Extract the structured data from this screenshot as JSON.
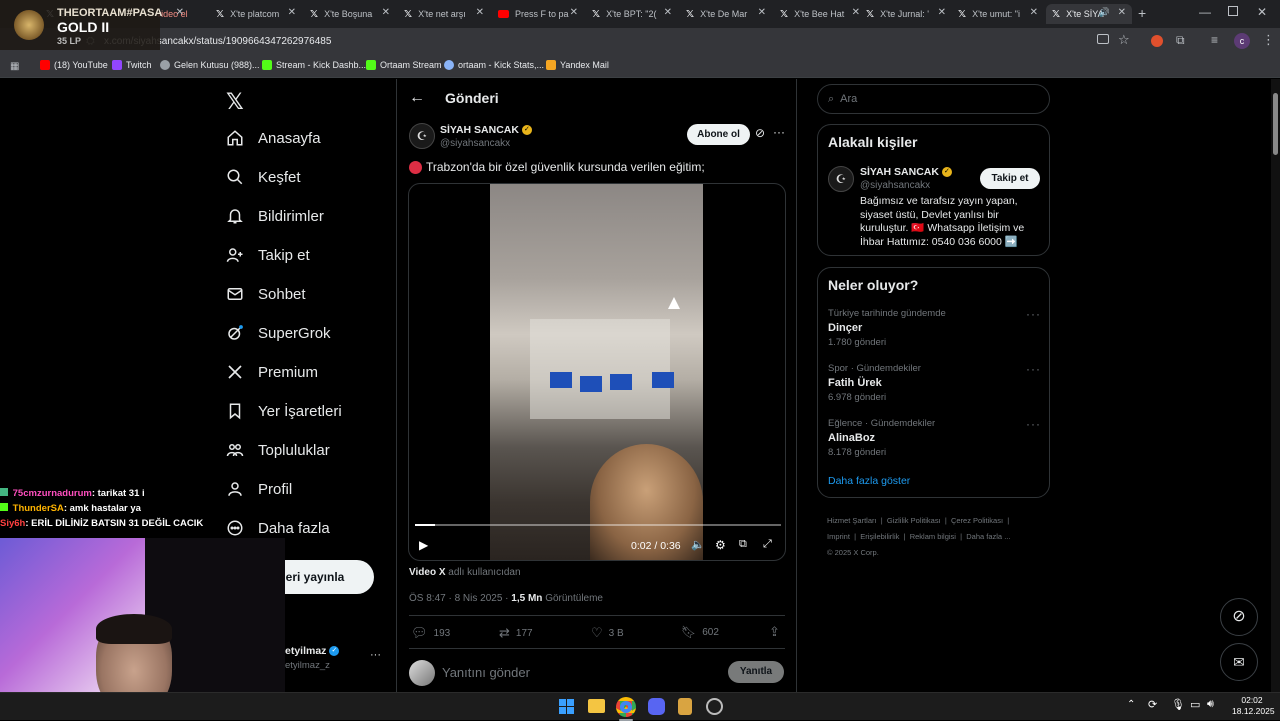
{
  "browser": {
    "tabs": [
      {
        "label": "St",
        "active": false
      },
      {
        "label": "X'te platcom",
        "active": false
      },
      {
        "label": "X'te Boşuna",
        "active": false
      },
      {
        "label": "X'te net arşı",
        "active": false
      },
      {
        "label": "Press F to pa",
        "active": false
      },
      {
        "label": "X'te BPT: \"2(",
        "active": false
      },
      {
        "label": "X'te De Mar",
        "active": false
      },
      {
        "label": "X'te Bee Hat",
        "active": false
      },
      {
        "label": "X'te Jurnal: '",
        "active": false
      },
      {
        "label": "X'te umut: \"i",
        "active": false
      },
      {
        "label": "X'te SİYA",
        "active": true
      }
    ],
    "url": "x.com/siyahsancakx/status/1909664347262976485",
    "bookmarks": [
      "(18) YouTube",
      "Twitch",
      "Gelen Kutusu (988)...",
      "Stream - Kick Dashb...",
      "Ortaam Stream",
      "ortaam - Kick Stats,...",
      "Yandex Mail"
    ]
  },
  "stream_overlay": {
    "name": "THEORTAAM#PASA",
    "rank": "GOLD II",
    "lp": "35 LP",
    "tab_fragment": "video el"
  },
  "sidebar": {
    "items": [
      {
        "label": "Anasayfa",
        "icon": "home-icon"
      },
      {
        "label": "Keşfet",
        "icon": "search-icon"
      },
      {
        "label": "Bildirimler",
        "icon": "bell-icon"
      },
      {
        "label": "Takip et",
        "icon": "follow-icon"
      },
      {
        "label": "Sohbet",
        "icon": "mail-icon"
      },
      {
        "label": "SuperGrok",
        "icon": "grok-icon"
      },
      {
        "label": "Premium",
        "icon": "x-logo-icon"
      },
      {
        "label": "Yer İşaretleri",
        "icon": "bookmark-icon"
      },
      {
        "label": "Topluluklar",
        "icon": "communities-icon"
      },
      {
        "label": "Profil",
        "icon": "profile-icon"
      },
      {
        "label": "Daha fazla",
        "icon": "more-icon"
      }
    ],
    "post_button": "eri yayınla",
    "account_name": "etyilmaz",
    "account_handle": "etyilmaz_z"
  },
  "post": {
    "header_title": "Gönderi",
    "author_name": "SİYAH SANCAK",
    "author_handle": "@siyahsancakx",
    "subscribe_label": "Abone ol",
    "text": "Trabzon'da bir özel güvenlik kursunda verilen eğitim;",
    "video_time": "0:02 / 0:36",
    "video_progress": 0.056,
    "source_prefix": "Video X",
    "source_suffix": "adlı kullanıcıdan",
    "timestamp": "ÖS 8:47 · 8 Nis 2025 ·",
    "views": "1,5 Mn",
    "views_label": "Görüntüleme",
    "replies": "193",
    "reposts": "177",
    "likes": "3 B",
    "bookmarks": "602",
    "reply_placeholder": "Yanıtını gönder",
    "reply_button": "Yanıtla"
  },
  "right": {
    "search_placeholder": "Ara",
    "related_title": "Alakalı kişiler",
    "related_name": "SİYAH SANCAK",
    "related_handle": "@siyahsancakx",
    "follow_label": "Takip et",
    "related_bio": "Bağımsız ve tarafsız yayın yapan, siyaset üstü, Devlet yanlısı bir kuruluştur. 🇹🇷 Whatsapp İletişim ve İhbar Hattımız: 0540 036 6000 ➡️",
    "trends_title": "Neler oluyor?",
    "trends": [
      {
        "meta": "Türkiye tarihinde gündemde",
        "name": "Dinçer",
        "count": "1.780 gönderi"
      },
      {
        "meta": "Spor · Gündemdekiler",
        "name": "Fatih Ürek",
        "count": "6.978 gönderi"
      },
      {
        "meta": "Eğlence · Gündemdekiler",
        "name": "AlinaBoz",
        "count": "8.178 gönderi"
      }
    ],
    "show_more": "Daha fazla göster",
    "footer_links": [
      "Hizmet Şartları",
      "Gizlilik Politikası",
      "Çerez Politikası",
      "Imprint",
      "Erişilebilirlik",
      "Reklam bilgisi",
      "Daha fazla ..."
    ],
    "copyright": "© 2025 X Corp."
  },
  "chat": [
    {
      "user": "75cmzurnadurum",
      "msg": ": tarikat 31 i",
      "color": "#ff4fbf"
    },
    {
      "user": "ThunderSA",
      "msg": ": amk hastalar ya",
      "color": "#ffb400"
    },
    {
      "user": "Siy6h",
      "msg": ": ERİL DİLİNİZ BATSIN 31 DEĞİL CACIK",
      "color": "#ff4040"
    }
  ],
  "taskbar": {
    "time": "02:02",
    "date": "18.12.2025"
  },
  "colors": {
    "accent": "#1d9bf0",
    "text": "#e7e9ea",
    "muted": "#71767b",
    "border": "#2f3336"
  }
}
